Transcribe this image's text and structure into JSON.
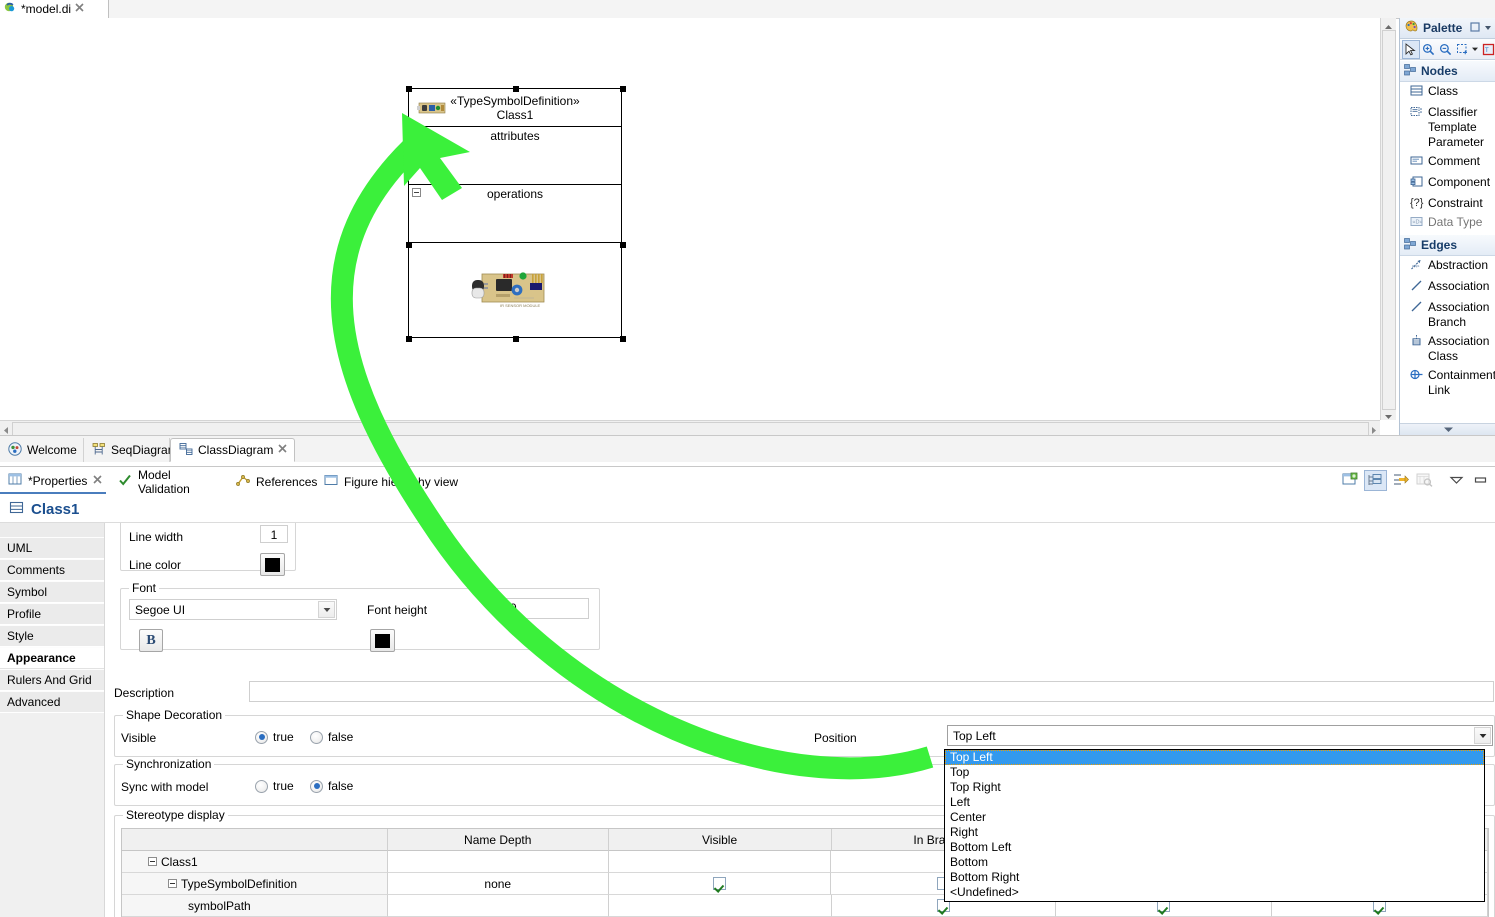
{
  "window": {
    "editor_tab": {
      "title": "*model.di",
      "close": "✕",
      "icon": "papyrus-model-icon"
    }
  },
  "diagram": {
    "class_node": {
      "stereotype": "«TypeSymbolDefinition»",
      "name": "Class1",
      "attributes_label": "attributes",
      "operations_label": "operations",
      "symbol_image_alt": "ir-sensor-module-image"
    }
  },
  "palette": {
    "title": "Palette",
    "tools": [
      "select-arrow-icon",
      "zoom-in-icon",
      "zoom-out-icon",
      "marquee-icon",
      "chevron-down-icon",
      "format-icon"
    ],
    "groups": [
      {
        "name": "Nodes",
        "items": [
          {
            "label": "Class",
            "icon": "class-icon"
          },
          {
            "label": "Classifier Template Parameter",
            "icon": "template-parameter-icon"
          },
          {
            "label": "Comment",
            "icon": "comment-icon"
          },
          {
            "label": "Component",
            "icon": "component-icon"
          },
          {
            "label": "Constraint",
            "icon": "constraint-icon"
          },
          {
            "label": "Data Type",
            "icon": "datatype-icon"
          }
        ]
      },
      {
        "name": "Edges",
        "items": [
          {
            "label": "Abstraction",
            "icon": "abstraction-icon"
          },
          {
            "label": "Association",
            "icon": "association-icon"
          },
          {
            "label": "Association Branch",
            "icon": "association-branch-icon"
          },
          {
            "label": "Association Class",
            "icon": "association-class-icon"
          },
          {
            "label": "Containment Link",
            "icon": "containment-link-icon"
          }
        ]
      }
    ]
  },
  "view_tabs": [
    {
      "label": "Welcome",
      "icon": "welcome-icon",
      "active": false,
      "closable": false
    },
    {
      "label": "SeqDiagram",
      "icon": "seq-diagram-icon",
      "active": false,
      "closable": false
    },
    {
      "label": "ClassDiagram",
      "icon": "class-diagram-icon",
      "active": true,
      "closable": true,
      "close": "✕"
    }
  ],
  "property_tabs": [
    {
      "label": "*Properties",
      "icon": "properties-icon",
      "active": true,
      "close": "✕"
    },
    {
      "label": "Model Validation",
      "icon": "validation-check-icon",
      "active": false
    },
    {
      "label": "References",
      "icon": "references-icon",
      "active": false
    },
    {
      "label": "Figure hierarchy view",
      "icon": "figure-hierarchy-icon",
      "active": false
    }
  ],
  "property_toolbar": [
    "new-properties-view-icon",
    "show-categories-icon",
    "link-with-editor-icon",
    "filter-icon",
    "view-menu-icon",
    "minimize-icon"
  ],
  "properties": {
    "title": "Class1",
    "title_icon": "class-icon",
    "side_tabs": [
      "UML",
      "Comments",
      "Symbol",
      "Profile",
      "Style",
      "Appearance",
      "Rulers And Grid",
      "Advanced"
    ],
    "selected_side_tab": "Appearance",
    "line": {
      "width_label": "Line width",
      "width_value": "1",
      "color_label": "Line color",
      "color_value": "#000000"
    },
    "font": {
      "group_label": "Font",
      "family_value": "Segoe UI",
      "height_label": "Font height",
      "height_value": "9",
      "bold_label": "B",
      "color_value": "#000000"
    },
    "description": {
      "label": "Description",
      "value": ""
    },
    "shape_decoration": {
      "group_label": "Shape Decoration",
      "visible_label": "Visible",
      "true_label": "true",
      "false_label": "false",
      "selected": "true",
      "position_label": "Position",
      "position_value": "Top Left"
    },
    "synchronization": {
      "group_label": "Synchronization",
      "sync_label": "Sync with model",
      "true_label": "true",
      "false_label": "false",
      "selected": "false"
    },
    "stereotype_display": {
      "group_label": "Stereotype display",
      "columns": [
        "",
        "Name Depth",
        "Visible",
        "In Brackets"
      ],
      "rows": [
        {
          "name": "Class1",
          "indent": 0,
          "expander": true,
          "name_depth": "",
          "visible": null,
          "in_brackets": null
        },
        {
          "name": "TypeSymbolDefinition",
          "indent": 1,
          "expander": true,
          "name_depth": "none",
          "visible": true,
          "in_brackets": false
        },
        {
          "name": "symbolPath",
          "indent": 2,
          "expander": false,
          "name_depth": "",
          "visible": null,
          "in_brackets": true
        }
      ]
    }
  },
  "position_dropdown": {
    "selected": "Top Left",
    "options": [
      "Top Left",
      "Top",
      "Top Right",
      "Left",
      "Center",
      "Right",
      "Bottom Left",
      "Bottom",
      "Bottom Right",
      "<Undefined>"
    ]
  },
  "colors": {
    "highlight": "#3399ee",
    "annotation_arrow": "#3bf03b",
    "title_text": "#1b4f8f",
    "palette_header": "#173c68"
  }
}
